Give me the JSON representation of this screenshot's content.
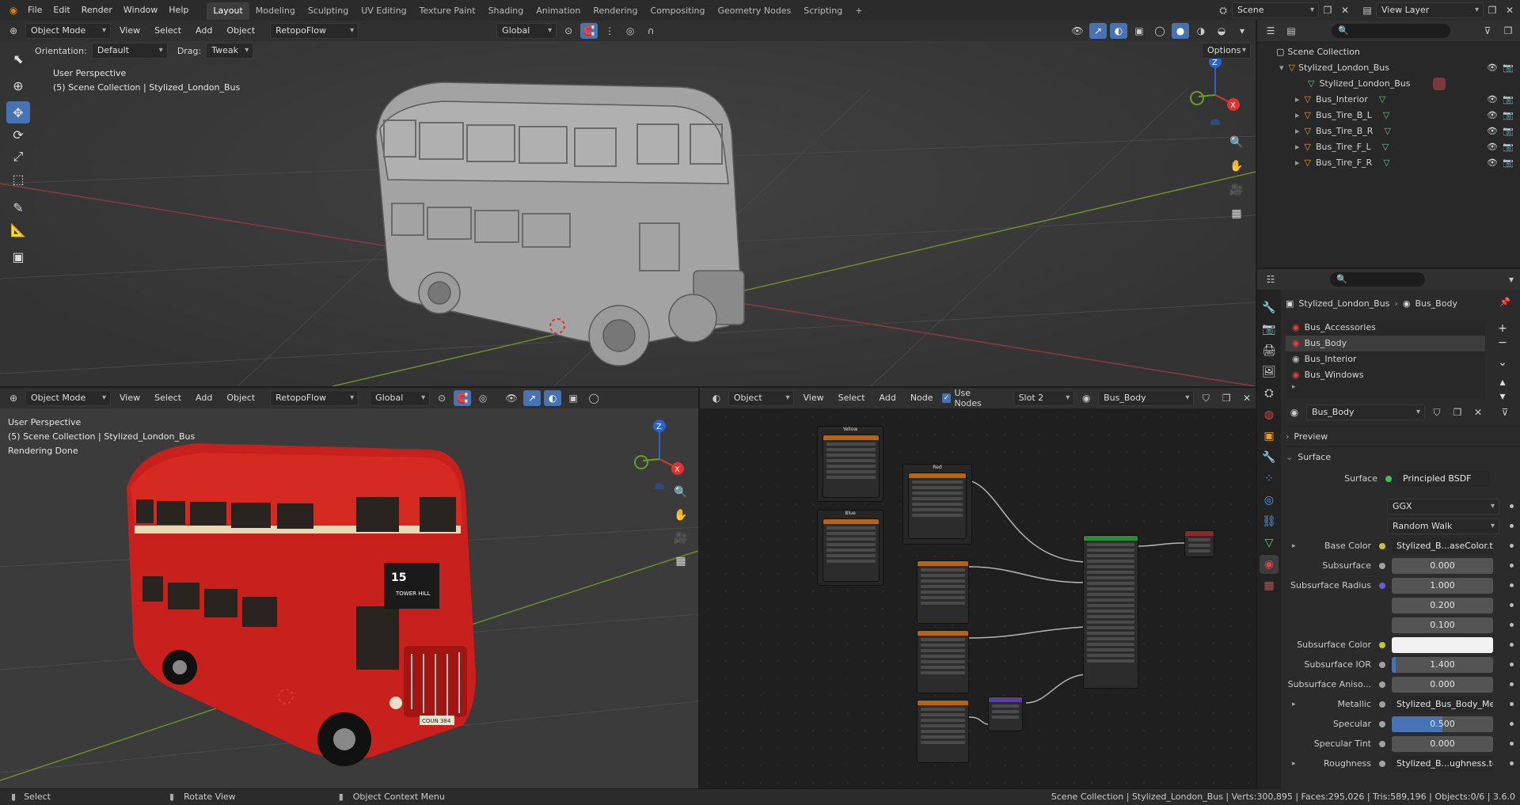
{
  "menus": [
    "File",
    "Edit",
    "Render",
    "Window",
    "Help"
  ],
  "workspaces": [
    "Layout",
    "Modeling",
    "Sculpting",
    "UV Editing",
    "Texture Paint",
    "Shading",
    "Animation",
    "Rendering",
    "Compositing",
    "Geometry Nodes",
    "Scripting"
  ],
  "scene": {
    "label": "Scene",
    "view_layer": "View Layer"
  },
  "vp1": {
    "mode": "Object Mode",
    "menus": [
      "View",
      "Select",
      "Add",
      "Object"
    ],
    "retopo": "RetopoFlow",
    "transform": "Global",
    "orientation_label": "Orientation:",
    "orientation": "Default",
    "drag_label": "Drag:",
    "drag": "Tweak",
    "options": "Options",
    "title": "User Perspective",
    "subtitle": "(5) Scene Collection | Stylized_London_Bus"
  },
  "vp2": {
    "mode": "Object Mode",
    "menus": [
      "View",
      "Select",
      "Add",
      "Object"
    ],
    "retopo": "RetopoFlow",
    "transform": "Global",
    "title": "User Perspective",
    "subtitle": "(5) Scene Collection | Stylized_London_Bus",
    "status": "Rendering Done",
    "bus_sign_number": "15",
    "bus_sign_dest": "TOWER HILL",
    "plate": "COUN 384"
  },
  "node_editor": {
    "type": "Object",
    "menus": [
      "View",
      "Select",
      "Add",
      "Node"
    ],
    "use_nodes": "Use Nodes",
    "slot": "Slot 2",
    "material": "Bus_Body",
    "frames": [
      "Yellow",
      "Red",
      "Blue"
    ]
  },
  "outliner": {
    "root": "Scene Collection",
    "collection": "Stylized_London_Bus",
    "items": [
      "Stylized_London_Bus",
      "Bus_Interior",
      "Bus_Tire_B_L",
      "Bus_Tire_B_R",
      "Bus_Tire_F_L",
      "Bus_Tire_F_R"
    ]
  },
  "properties": {
    "breadcrumb_object": "Stylized_London_Bus",
    "breadcrumb_material": "Bus_Body",
    "slots": [
      "Bus_Accessories",
      "Bus_Body",
      "Bus_Interior",
      "Bus_Windows"
    ],
    "material_name": "Bus_Body",
    "preview": "Preview",
    "surface_panel": "Surface",
    "surface_label": "Surface",
    "surface_value": "Principled BSDF",
    "distribution": "GGX",
    "subsurface_method": "Random Walk",
    "rows": [
      {
        "label": "Base Color",
        "value": "Stylized_B...aseColor.tga",
        "kind": "link",
        "socket": "#c7c729",
        "expand": true
      },
      {
        "label": "Subsurface",
        "value": "0.000",
        "kind": "num",
        "socket": "#a1a1a1"
      },
      {
        "label": "Subsurface Radius",
        "value": "1.000",
        "kind": "num",
        "socket": "#6363c7"
      },
      {
        "label": "",
        "value": "0.200",
        "kind": "num"
      },
      {
        "label": "",
        "value": "0.100",
        "kind": "num"
      },
      {
        "label": "Subsurface Color",
        "value": "",
        "kind": "color",
        "socket": "#c7c729"
      },
      {
        "label": "Subsurface IOR",
        "value": "1.400",
        "kind": "num",
        "socket": "#a1a1a1",
        "fill": 0.04
      },
      {
        "label": "Subsurface Aniso...",
        "value": "0.000",
        "kind": "num",
        "socket": "#a1a1a1"
      },
      {
        "label": "Metallic",
        "value": "Stylized_Bus_Body_Me...",
        "kind": "link",
        "socket": "#a1a1a1",
        "expand": true
      },
      {
        "label": "Specular",
        "value": "0.500",
        "kind": "num",
        "socket": "#a1a1a1",
        "fill": 0.5
      },
      {
        "label": "Specular Tint",
        "value": "0.000",
        "kind": "num",
        "socket": "#a1a1a1"
      },
      {
        "label": "Roughness",
        "value": "Stylized_B...ughness.tga",
        "kind": "link",
        "socket": "#a1a1a1",
        "expand": true
      }
    ]
  },
  "statusbar": {
    "select": "Select",
    "rotate": "Rotate View",
    "context": "Object Context Menu",
    "info": "Scene Collection | Stylized_London_Bus | Verts:300,895 | Faces:295,026 | Tris:589,196 | Objects:0/6 | 3.6.0"
  },
  "colors": {
    "accent": "#4772b3",
    "bus_red": "#c8201c",
    "header": "#303030"
  }
}
